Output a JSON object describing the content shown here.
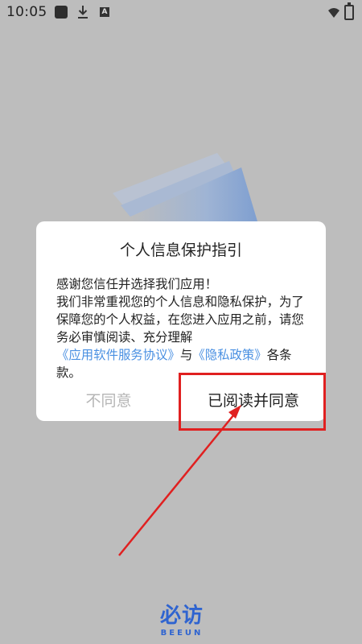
{
  "status_bar": {
    "time": "10:05",
    "icons": [
      "app-square-icon",
      "download-icon",
      "a-badge-icon",
      "wifi-icon",
      "battery-icon"
    ]
  },
  "dialog": {
    "title": "个人信息保护指引",
    "body_line1": "感谢您信任并选择我们应用！",
    "body_line2": "我们非常重视您的个人信息和隐私保护，为了保障您的个人权益，在您进入应用之前，请您务必审慎阅读、充分理解",
    "link_service": "《应用软件服务协议》",
    "conjunction": "与",
    "link_privacy": "《隐私政策》",
    "body_tail": "各条款。",
    "disagree_label": "不同意",
    "agree_label": "已阅读并同意"
  },
  "brand": {
    "name": "必访",
    "sub": "BEEUN"
  },
  "colors": {
    "overlay": "#bdbdbd",
    "accent_blue": "#4a90e2",
    "annotation_red": "#e02020",
    "brand_blue": "#2f64d0"
  }
}
